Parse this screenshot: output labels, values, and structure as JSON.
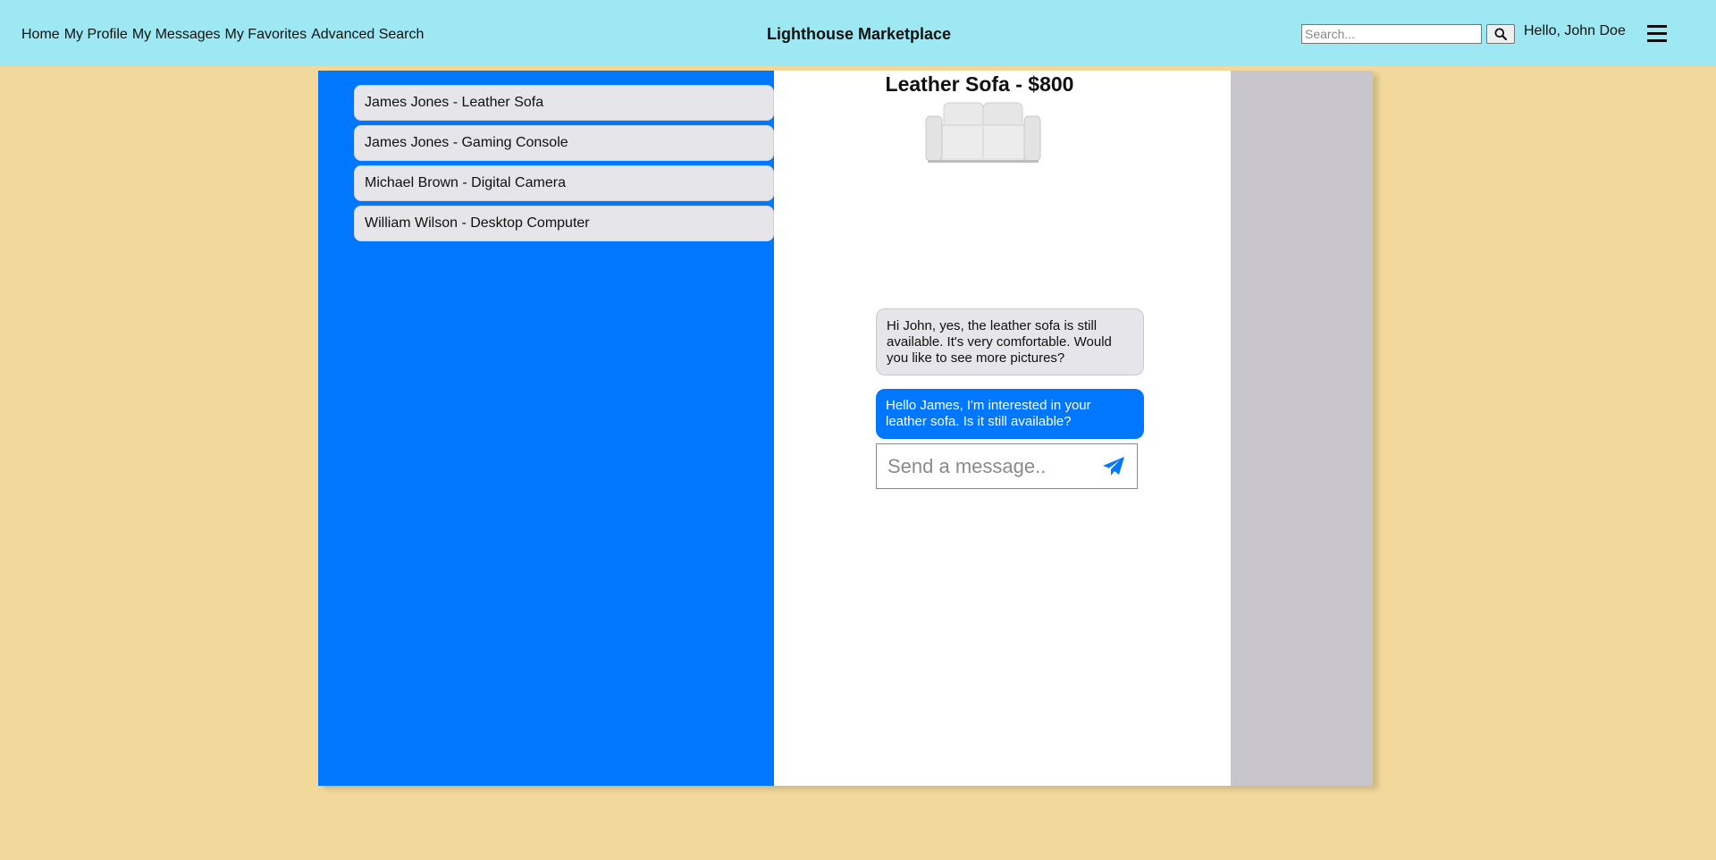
{
  "header": {
    "nav": [
      "Home",
      "My Profile",
      "My Messages",
      "My Favorites",
      "Advanced Search"
    ],
    "brand": "Lighthouse Marketplace",
    "search_placeholder": "Search...",
    "greeting": "Hello, John Doe",
    "search_icon": "search-icon",
    "menu_icon": "hamburger-menu-icon"
  },
  "conversations": [
    "James Jones - Leather Sofa",
    "James Jones - Gaming Console",
    "Michael Brown - Digital Camera",
    "William Wilson - Desktop Computer"
  ],
  "chat": {
    "listing_title": "Leather Sofa - $800",
    "messages": [
      {
        "direction": "received",
        "text": "Hi John, yes, the leather sofa is still available. It's very comfortable. Would you like to see more pictures?"
      },
      {
        "direction": "sent",
        "text": "Hello James, I'm interested in your leather sofa. Is it still available?"
      }
    ],
    "input_placeholder": "Send a message..",
    "send_icon": "paper-plane-icon"
  },
  "colors": {
    "page_bg": "#f2d99b",
    "header_bg": "#9de8f2",
    "sidebar_bg": "#0077ff",
    "bubble_received": "#e5e5ea",
    "bubble_sent": "#0077ff"
  }
}
